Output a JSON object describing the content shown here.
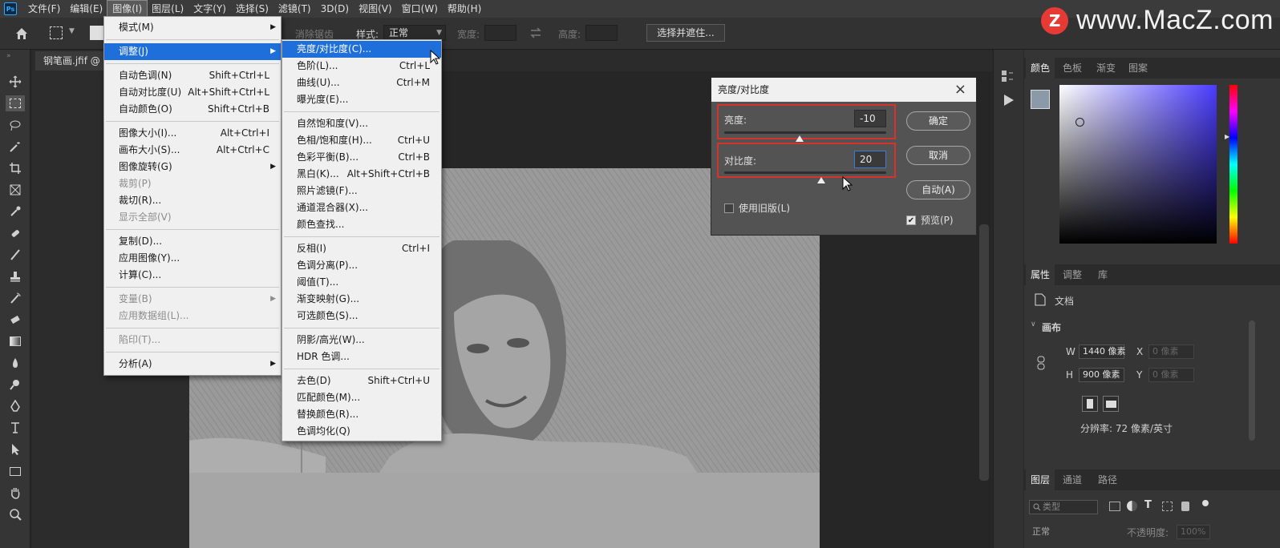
{
  "app": {
    "logo": "Ps"
  },
  "menubar": {
    "items": [
      "文件(F)",
      "编辑(E)",
      "图像(I)",
      "图层(L)",
      "文字(Y)",
      "选择(S)",
      "滤镜(T)",
      "3D(D)",
      "视图(V)",
      "窗口(W)",
      "帮助(H)"
    ],
    "active_index": 2
  },
  "watermark": {
    "logo_letter": "Z",
    "text": "www.MacZ.com"
  },
  "options_bar": {
    "remove_aliasing": "消除锯齿",
    "style_label": "样式:",
    "style_value": "正常",
    "width_label": "宽度:",
    "height_label": "高度:",
    "select_mask_button": "选择并遮住..."
  },
  "document_tab": {
    "label": "钢笔画.jfif @ 6"
  },
  "image_menu": {
    "items": [
      {
        "label": "模式(M)",
        "shortcut": "",
        "submenu": true,
        "disabled": false
      },
      {
        "sep": true
      },
      {
        "label": "调整(J)",
        "shortcut": "",
        "submenu": true,
        "disabled": false,
        "highlight": true
      },
      {
        "sep": true
      },
      {
        "label": "自动色调(N)",
        "shortcut": "Shift+Ctrl+L",
        "submenu": false,
        "disabled": false
      },
      {
        "label": "自动对比度(U)",
        "shortcut": "Alt+Shift+Ctrl+L",
        "submenu": false,
        "disabled": false
      },
      {
        "label": "自动颜色(O)",
        "shortcut": "Shift+Ctrl+B",
        "submenu": false,
        "disabled": false
      },
      {
        "sep": true
      },
      {
        "label": "图像大小(I)...",
        "shortcut": "Alt+Ctrl+I",
        "submenu": false,
        "disabled": false
      },
      {
        "label": "画布大小(S)...",
        "shortcut": "Alt+Ctrl+C",
        "submenu": false,
        "disabled": false
      },
      {
        "label": "图像旋转(G)",
        "shortcut": "",
        "submenu": true,
        "disabled": false
      },
      {
        "label": "裁剪(P)",
        "shortcut": "",
        "submenu": false,
        "disabled": true
      },
      {
        "label": "裁切(R)...",
        "shortcut": "",
        "submenu": false,
        "disabled": false
      },
      {
        "label": "显示全部(V)",
        "shortcut": "",
        "submenu": false,
        "disabled": true
      },
      {
        "sep": true
      },
      {
        "label": "复制(D)...",
        "shortcut": "",
        "submenu": false,
        "disabled": false
      },
      {
        "label": "应用图像(Y)...",
        "shortcut": "",
        "submenu": false,
        "disabled": false
      },
      {
        "label": "计算(C)...",
        "shortcut": "",
        "submenu": false,
        "disabled": false
      },
      {
        "sep": true
      },
      {
        "label": "变量(B)",
        "shortcut": "",
        "submenu": true,
        "disabled": true
      },
      {
        "label": "应用数据组(L)...",
        "shortcut": "",
        "submenu": false,
        "disabled": true
      },
      {
        "sep": true
      },
      {
        "label": "陷印(T)...",
        "shortcut": "",
        "submenu": false,
        "disabled": true
      },
      {
        "sep": true
      },
      {
        "label": "分析(A)",
        "shortcut": "",
        "submenu": true,
        "disabled": false
      }
    ]
  },
  "adjust_menu": {
    "items": [
      {
        "label": "亮度/对比度(C)...",
        "shortcut": "",
        "highlight": true
      },
      {
        "label": "色阶(L)...",
        "shortcut": "Ctrl+L"
      },
      {
        "label": "曲线(U)...",
        "shortcut": "Ctrl+M"
      },
      {
        "label": "曝光度(E)...",
        "shortcut": ""
      },
      {
        "sep": true
      },
      {
        "label": "自然饱和度(V)...",
        "shortcut": ""
      },
      {
        "label": "色相/饱和度(H)...",
        "shortcut": "Ctrl+U"
      },
      {
        "label": "色彩平衡(B)...",
        "shortcut": "Ctrl+B"
      },
      {
        "label": "黑白(K)...",
        "shortcut": "Alt+Shift+Ctrl+B"
      },
      {
        "label": "照片滤镜(F)...",
        "shortcut": ""
      },
      {
        "label": "通道混合器(X)...",
        "shortcut": ""
      },
      {
        "label": "颜色查找...",
        "shortcut": ""
      },
      {
        "sep": true
      },
      {
        "label": "反相(I)",
        "shortcut": "Ctrl+I"
      },
      {
        "label": "色调分离(P)...",
        "shortcut": ""
      },
      {
        "label": "阈值(T)...",
        "shortcut": ""
      },
      {
        "label": "渐变映射(G)...",
        "shortcut": ""
      },
      {
        "label": "可选颜色(S)...",
        "shortcut": ""
      },
      {
        "sep": true
      },
      {
        "label": "阴影/高光(W)...",
        "shortcut": ""
      },
      {
        "label": "HDR 色调...",
        "shortcut": ""
      },
      {
        "sep": true
      },
      {
        "label": "去色(D)",
        "shortcut": "Shift+Ctrl+U"
      },
      {
        "label": "匹配颜色(M)...",
        "shortcut": ""
      },
      {
        "label": "替换颜色(R)...",
        "shortcut": ""
      },
      {
        "label": "色调均化(Q)",
        "shortcut": ""
      }
    ]
  },
  "dialog": {
    "title": "亮度/对比度",
    "brightness_label": "亮度:",
    "brightness_value": "-10",
    "contrast_label": "对比度:",
    "contrast_value": "20",
    "ok_button": "确定",
    "cancel_button": "取消",
    "auto_button": "自动(A)",
    "legacy_label": "使用旧版(L)",
    "legacy_checked": false,
    "preview_label": "预览(P)",
    "preview_checked": true
  },
  "color_panel": {
    "tabs": [
      "颜色",
      "色板",
      "渐变",
      "图案"
    ],
    "active": 0
  },
  "properties_panel": {
    "tabs": [
      "属性",
      "调整",
      "库"
    ],
    "doc_label": "文档",
    "canvas_section": "画布",
    "w_label": "W",
    "w_value": "1440 像素",
    "h_label": "H",
    "h_value": "900 像素",
    "x_label": "X",
    "x_placeholder": "0 像素",
    "y_label": "Y",
    "y_placeholder": "0 像素",
    "resolution": "分辨率: 72 像素/英寸"
  },
  "layers_panel": {
    "tabs": [
      "图层",
      "通道",
      "路径"
    ],
    "filter_placeholder": "类型",
    "blend_mode": "正常",
    "opacity_label": "不透明度:",
    "opacity_value": "100%"
  }
}
